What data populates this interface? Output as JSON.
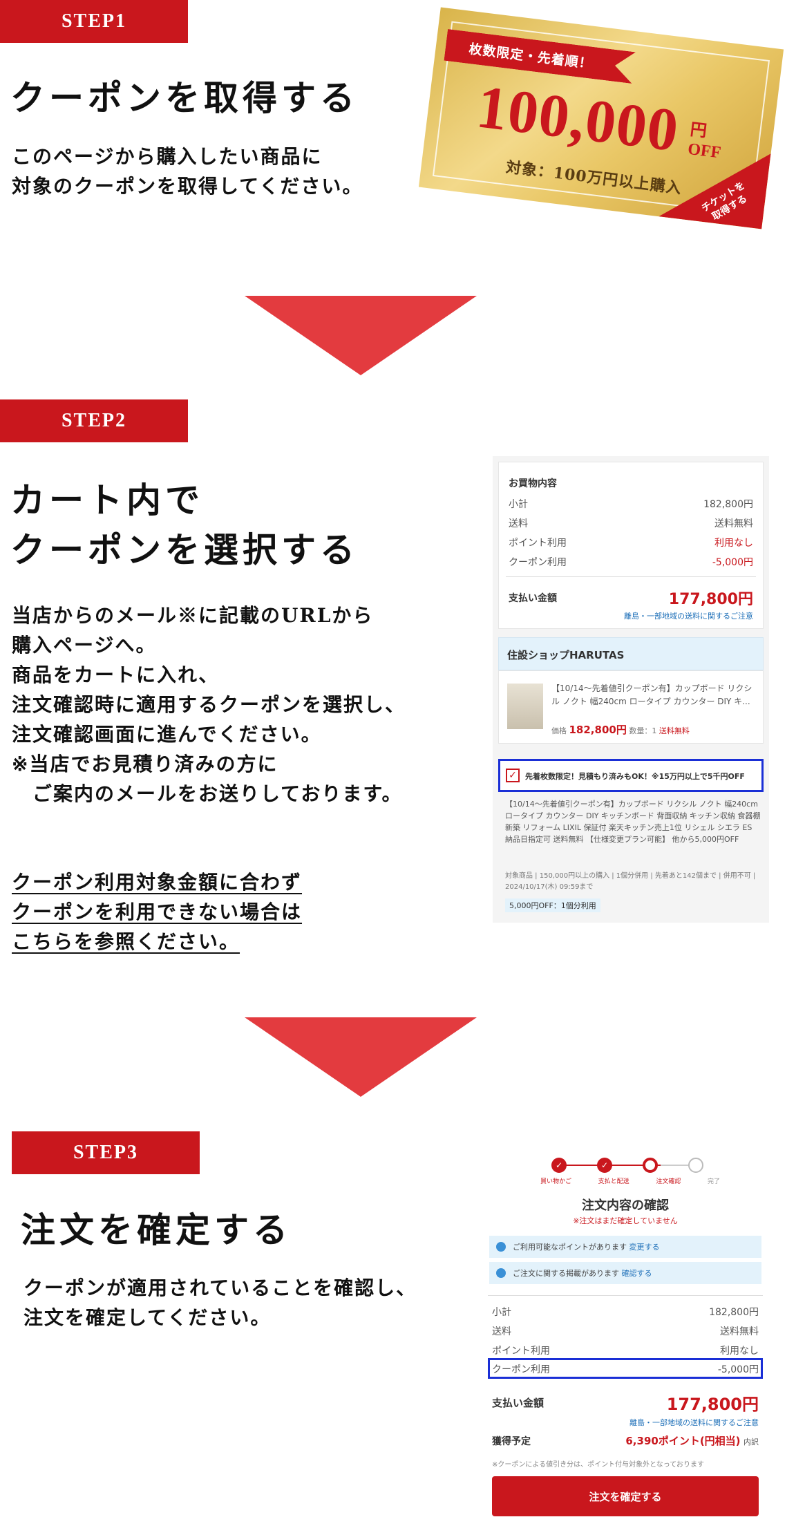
{
  "step1": {
    "label": "STEP1",
    "title": "クーポンを取得する",
    "text": "このページから購入したい商品に\n対象のクーポンを取得してください。",
    "coupon": {
      "ribbon": "枚数限定・先着順！",
      "amount": "100,000",
      "unit_yen": "円",
      "unit_off": "OFF",
      "target": "対象：100万円以上購入",
      "corner": "チケットを\n取得する"
    }
  },
  "step2": {
    "label": "STEP2",
    "title": "カート内で\nクーポンを選択する",
    "text": "当店からのメール※に記載のURLから\n購入ページへ。\n商品をカートに入れ、\n注文確認時に適用するクーポンを選択し、\n注文確認画面に進んでください。\n※当店でお見積り済みの方に\n　ご案内のメールをお送りしております。",
    "link": "クーポン利用対象金額に合わず\nクーポンを利用できない場合は\nこちらを参照ください。",
    "cart": {
      "heading": "お買物内容",
      "rows": [
        {
          "label": "小計",
          "value": "182,800円"
        },
        {
          "label": "送料",
          "value": "送料無料"
        },
        {
          "label": "ポイント利用",
          "value": "利用なし"
        },
        {
          "label": "クーポン利用",
          "value": "-5,000円"
        }
      ],
      "total_label": "支払い金額",
      "total_value": "177,800円",
      "note": "離島・一部地域の送料に関するご注意",
      "shop": "住設ショップHARUTAS",
      "product": "【10/14〜先着値引クーポン有】カップボード リクシル ノクト 幅240cm ロータイプ カウンター DIY キ...",
      "price_label": "価格",
      "price": "182,800円",
      "qty": "数量：1",
      "shipping": "送料無料",
      "coupon_check": "先着枚数限定！見積もり済みもOK！※15万円以上で5千円OFF",
      "coupon_desc": "【10/14〜先着値引クーポン有】カップボード リクシル ノクト 幅240cm ロータイプ カウンター DIY キッチンボード 背面収納 キッチン収納 食器棚 新築 リフォーム LIXIL 保証付 楽天キッチン売上1位 リシェル シエラ ES 納品日指定可 送料無料 【仕様変更プラン可能】 他から5,000円OFF",
      "coupon_cond": "対象商品 | 150,000円以上の購入 | 1個分併用 | 先着あと142個まで | 併用不可 | 2024/10/17(木) 09:59まで",
      "coupon_tag": "5,000円OFF：1個分利用"
    }
  },
  "step3": {
    "label": "STEP3",
    "title": "注文を確定する",
    "text": "クーポンが適用されていることを確認し、\n注文を確定してください。",
    "confirm": {
      "steps": [
        "買い物かご",
        "支払と配送",
        "注文確認",
        "完了"
      ],
      "heading": "注文内容の確認",
      "warning": "※注文はまだ確定していません",
      "info1": "ご利用可能なポイントがあります",
      "info1_link": "変更する",
      "info2": "ご注文に関する掲載があります",
      "info2_link": "確認する",
      "rows": [
        {
          "label": "小計",
          "value": "182,800円"
        },
        {
          "label": "送料",
          "value": "送料無料"
        },
        {
          "label": "ポイント利用",
          "value": "利用なし"
        },
        {
          "label": "クーポン利用",
          "value": "-5,000円"
        }
      ],
      "total_label": "支払い金額",
      "total_value": "177,800円",
      "note": "離島・一部地域の送料に関するご注意",
      "points_label": "獲得予定",
      "points_value": "6,390ポイント(円相当)",
      "points_note": "内訳",
      "coupon_note": "※クーポンによる値引き分は、ポイント付与対象外となっております",
      "button": "注文を確定する"
    }
  },
  "colors": {
    "accent": "#c9171d",
    "arrow": "#e33b3f",
    "highlight": "#1a2fd6"
  }
}
